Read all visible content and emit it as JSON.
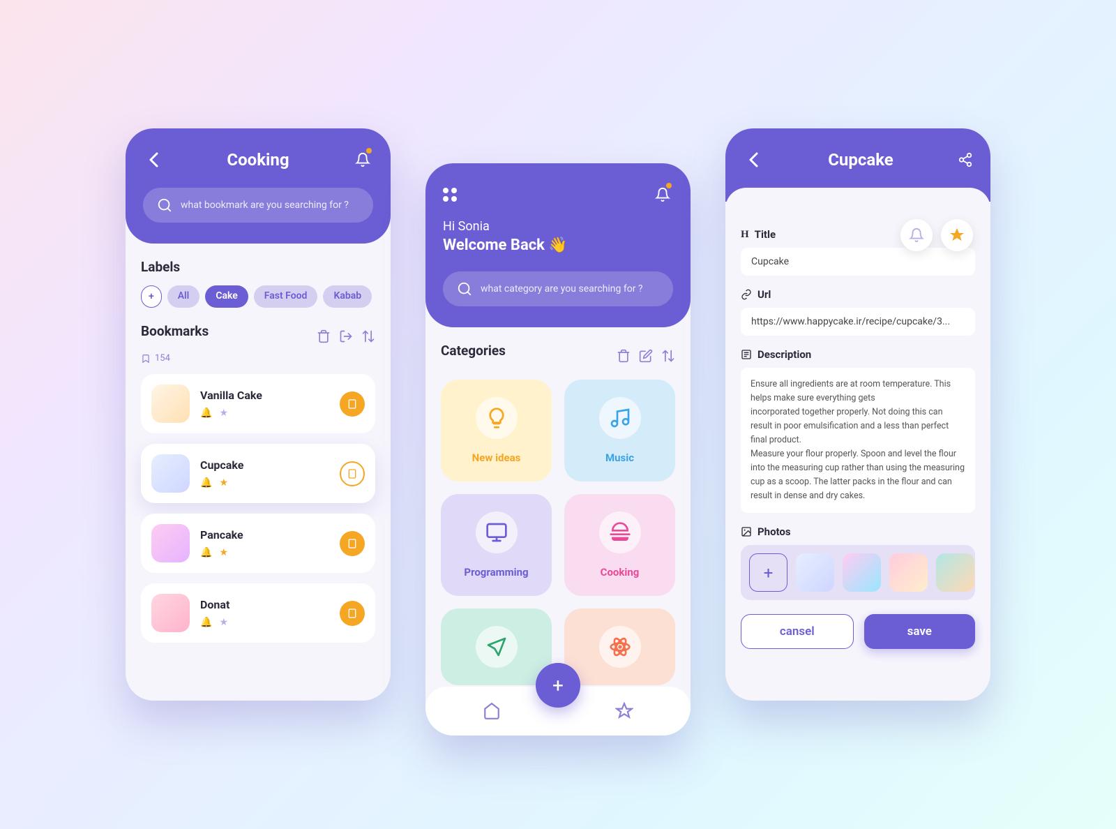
{
  "screen1": {
    "title": "Cooking",
    "search_placeholder": "what bookmark are you searching for ?",
    "labels_title": "Labels",
    "chips": [
      "All",
      "Cake",
      "Fast Food",
      "Kabab"
    ],
    "bookmarks_title": "Bookmarks",
    "bookmarks_count": "154",
    "bookmarks": [
      {
        "title": "Vanilla Cake",
        "bell": false,
        "star": false,
        "thumb_bg": "linear-gradient(135deg,#fff5e6,#ffe0b3)"
      },
      {
        "title": "Cupcake",
        "bell": false,
        "star": true,
        "thumb_bg": "linear-gradient(135deg,#e6eeff,#cfd6ff)"
      },
      {
        "title": "Pancake",
        "bell": true,
        "star": true,
        "thumb_bg": "linear-gradient(135deg,#ffccf2,#e6b3ff)"
      },
      {
        "title": "Donat",
        "bell": false,
        "star": false,
        "thumb_bg": "linear-gradient(135deg,#ffd6e0,#ffb3cc)"
      }
    ]
  },
  "screen2": {
    "greeting": "Hi Sonia",
    "welcome": "Welcome Back 👋",
    "search_placeholder": "what category are you searching for ?",
    "categories_title": "Categories",
    "cats": [
      {
        "label": "New ideas",
        "bg": "#fff2cc",
        "color": "#f5a623"
      },
      {
        "label": "Music",
        "bg": "#d4ecf9",
        "color": "#3aa3e8"
      },
      {
        "label": "Programming",
        "bg": "#e0d9f7",
        "color": "#6b5dd3"
      },
      {
        "label": "Cooking",
        "bg": "#fadcf0",
        "color": "#ec4899"
      },
      {
        "label": "",
        "bg": "#cdeee2",
        "color": "#2ba56d"
      },
      {
        "label": "",
        "bg": "#fce0d4",
        "color": "#f5704d"
      }
    ]
  },
  "screen3": {
    "title": "Cupcake",
    "form": {
      "title_label": "Title",
      "title_value": "Cupcake",
      "url_label": "Url",
      "url_value": "https://www.happycake.ir/recipe/cupcake/3...",
      "desc_label": "Description",
      "desc_value": "Ensure all ingredients are at room temperature. This helps make sure everything gets\nincorporated together properly. Not doing this can result in poor emulsification and a less than perfect final product.\nMeasure your flour properly. Spoon and level the flour into the measuring cup rather than using the measuring cup as a scoop. The latter packs in the flour and can result in dense and dry cakes.",
      "photos_label": "Photos"
    },
    "cancel": "cansel",
    "save": "save",
    "photos": [
      "linear-gradient(135deg,#e6eeff,#cfd6ff)",
      "linear-gradient(135deg,#ffccf2,#99e6ff)",
      "linear-gradient(135deg,#ffccdd,#ffeecc)",
      "linear-gradient(135deg,#b3e6e6,#ffd9b3)"
    ]
  }
}
